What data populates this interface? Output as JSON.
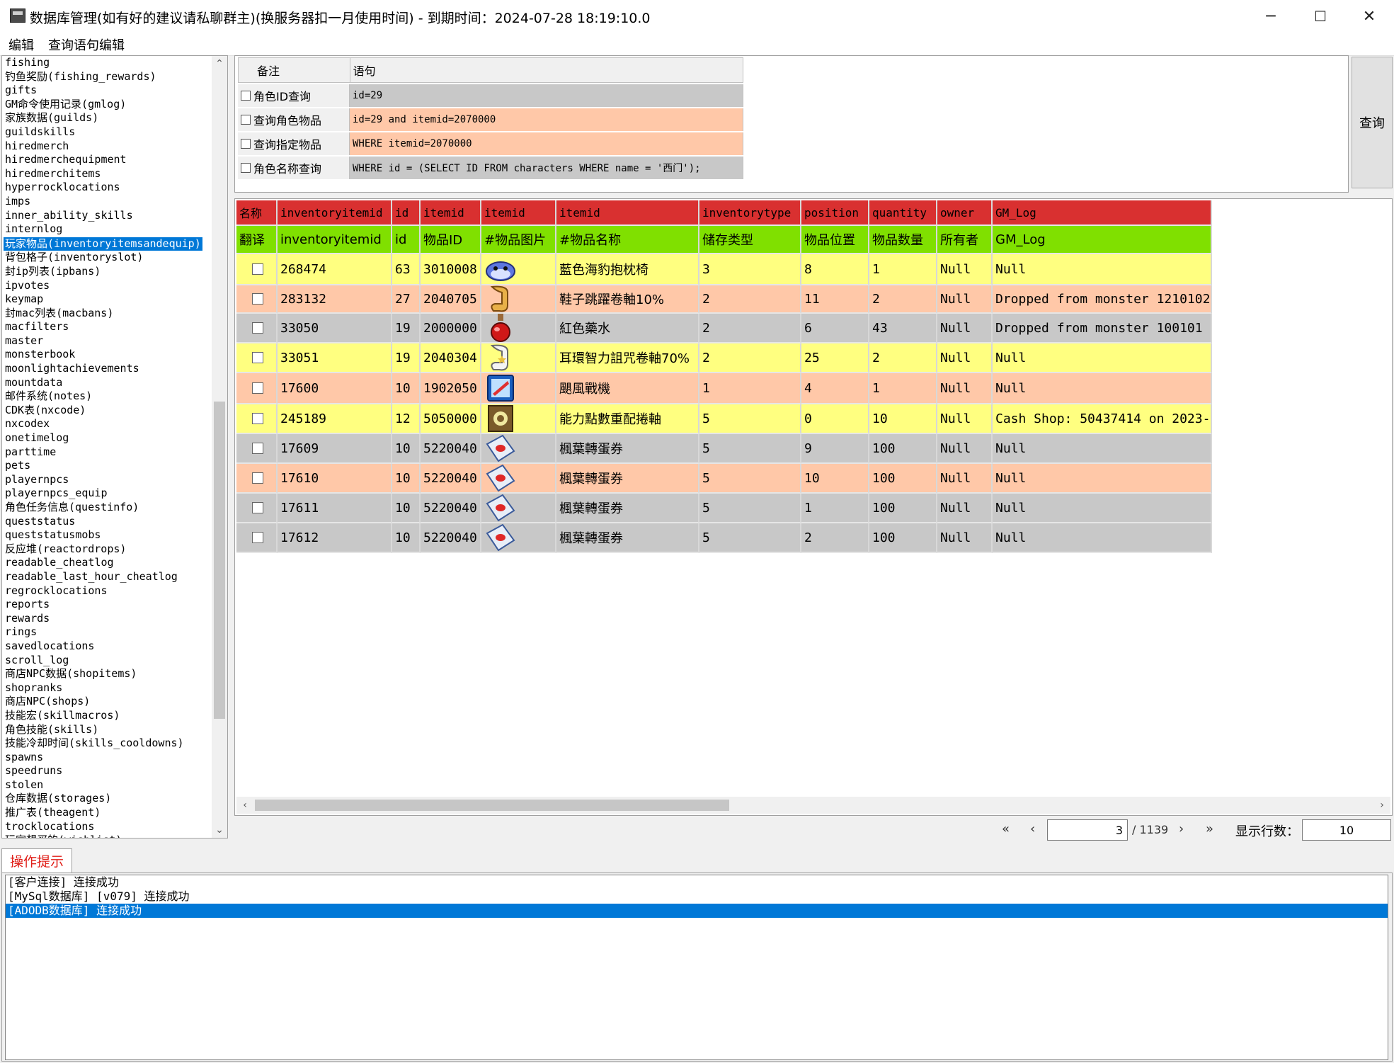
{
  "window": {
    "title": "数据库管理(如有好的建议请私聊群主)(换服务器扣一月使用时间) - 到期时间：2024-07-28 18:19:10.0",
    "minimize": "─",
    "maximize": "☐",
    "close": "✕"
  },
  "menu": {
    "items": [
      "编辑",
      "查询语句编辑"
    ]
  },
  "table_list": {
    "selected_index": 13,
    "items": [
      "fishing",
      "钓鱼奖励(fishing_rewards)",
      "gifts",
      "GM命令使用记录(gmlog)",
      "家族数据(guilds)",
      "guildskills",
      "hiredmerch",
      "hiredmerchequipment",
      "hiredmerchitems",
      "hyperrocklocations",
      "imps",
      "inner_ability_skills",
      "internlog",
      "玩家物品(inventoryitemsandequip)",
      "背包格子(inventoryslot)",
      "封ip列表(ipbans)",
      "ipvotes",
      "keymap",
      "封mac列表(macbans)",
      "macfilters",
      "master",
      "monsterbook",
      "moonlightachievements",
      "mountdata",
      "邮件系统(notes)",
      "CDK表(nxcode)",
      "nxcodex",
      "onetimelog",
      "parttime",
      "pets",
      "playernpcs",
      "playernpcs_equip",
      "角色任务信息(questinfo)",
      "queststatus",
      "queststatusmobs",
      "反应堆(reactordrops)",
      "readable_cheatlog",
      "readable_last_hour_cheatlog",
      "regrocklocations",
      "reports",
      "rewards",
      "rings",
      "savedlocations",
      "scroll_log",
      "商店NPC数据(shopitems)",
      "shopranks",
      "商店NPC(shops)",
      "技能宏(skillmacros)",
      "角色技能(skills)",
      "技能冷却时间(skills_cooldowns)",
      "spawns",
      "speedruns",
      "stolen",
      "仓库数据(storages)",
      "推广表(theagent)",
      "trocklocations",
      "玩家想买的(wishlist)"
    ]
  },
  "query_table": {
    "headers": [
      "备注",
      "语句"
    ],
    "rows": [
      {
        "note": "角色ID查询",
        "sql": "id=29",
        "color": "#c8c8c8"
      },
      {
        "note": "查询角色物品",
        "sql": "id=29 and itemid=2070000",
        "color": "#ffc8a8"
      },
      {
        "note": "查询指定物品",
        "sql": "WHERE itemid=2070000",
        "color": "#ffc8a8"
      },
      {
        "note": "角色名称查询",
        "sql": "WHERE id = (SELECT ID FROM characters WHERE name = '西门');",
        "color": "#c8c8c8"
      }
    ],
    "query_button": "查询"
  },
  "grid": {
    "header_color": "#d93030",
    "translate_color": "#80e000",
    "columns": [
      {
        "name": "名称",
        "trans": "翻译"
      },
      {
        "name": "inventoryitemid",
        "trans": "inventoryitemid"
      },
      {
        "name": "id",
        "trans": "id"
      },
      {
        "name": "itemid",
        "trans": "物品ID"
      },
      {
        "name": "itemid",
        "trans": "#物品图片"
      },
      {
        "name": "itemid",
        "trans": "#物品名称"
      },
      {
        "name": "inventorytype",
        "trans": "储存类型"
      },
      {
        "name": "position",
        "trans": "物品位置"
      },
      {
        "name": "quantity",
        "trans": "物品数量"
      },
      {
        "name": "owner",
        "trans": "所有者"
      },
      {
        "name": "GM_Log",
        "trans": "GM_Log"
      }
    ],
    "rows": [
      {
        "color": "#ffff80",
        "icon": "pillow-icon",
        "cells": [
          "268474",
          "63",
          "3010008",
          "藍色海豹抱枕椅",
          "3",
          "8",
          "1",
          "Null",
          "Null"
        ]
      },
      {
        "color": "#ffc8a8",
        "icon": "scroll-gold-icon",
        "cells": [
          "283132",
          "27",
          "2040705",
          "鞋子跳躍卷軸10%",
          "2",
          "11",
          "2",
          "Null",
          "Dropped from monster 1210102"
        ]
      },
      {
        "color": "#c8c8c8",
        "icon": "red-potion-icon",
        "cells": [
          "33050",
          "19",
          "2000000",
          "紅色藥水",
          "2",
          "6",
          "43",
          "Null",
          "Dropped from monster 100101"
        ]
      },
      {
        "color": "#ffff80",
        "icon": "scroll-white-icon",
        "cells": [
          "33051",
          "19",
          "2040304",
          "耳環智力詛咒卷軸70%",
          "2",
          "25",
          "2",
          "Null",
          "Null"
        ]
      },
      {
        "color": "#ffc8a8",
        "icon": "skill-book-icon",
        "cells": [
          "17600",
          "10",
          "1902050",
          "颶風戰機",
          "1",
          "4",
          "1",
          "Null",
          "Null"
        ]
      },
      {
        "color": "#ffff80",
        "icon": "reset-scroll-icon",
        "cells": [
          "245189",
          "12",
          "5050000",
          "能力點數重配捲軸",
          "5",
          "0",
          "10",
          "Null",
          "Cash Shop: 50437414 on 2023-"
        ]
      },
      {
        "color": "#c8c8c8",
        "icon": "gacha-ticket-icon",
        "cells": [
          "17609",
          "10",
          "5220040",
          "楓葉轉蛋券",
          "5",
          "9",
          "100",
          "Null",
          "Null"
        ]
      },
      {
        "color": "#ffc8a8",
        "icon": "gacha-ticket-icon",
        "cells": [
          "17610",
          "10",
          "5220040",
          "楓葉轉蛋券",
          "5",
          "10",
          "100",
          "Null",
          "Null"
        ]
      },
      {
        "color": "#c8c8c8",
        "icon": "gacha-ticket-icon",
        "cells": [
          "17611",
          "10",
          "5220040",
          "楓葉轉蛋券",
          "5",
          "1",
          "100",
          "Null",
          "Null"
        ]
      },
      {
        "color": "#c8c8c8",
        "icon": "gacha-ticket-icon",
        "cells": [
          "17612",
          "10",
          "5220040",
          "楓葉轉蛋券",
          "5",
          "2",
          "100",
          "Null",
          "Null"
        ]
      }
    ]
  },
  "pager": {
    "first": "«",
    "prev": "‹",
    "current_page": "3",
    "total": "/ 1139",
    "next": "›",
    "last": "»",
    "rows_label": "显示行数：",
    "rows_value": "10"
  },
  "log": {
    "tab": "操作提示",
    "lines": [
      "[客户连接] 连接成功",
      "[MySql数据库] [v079] 连接成功",
      "[ADODB数据库] 连接成功"
    ],
    "selected_index": 2
  }
}
